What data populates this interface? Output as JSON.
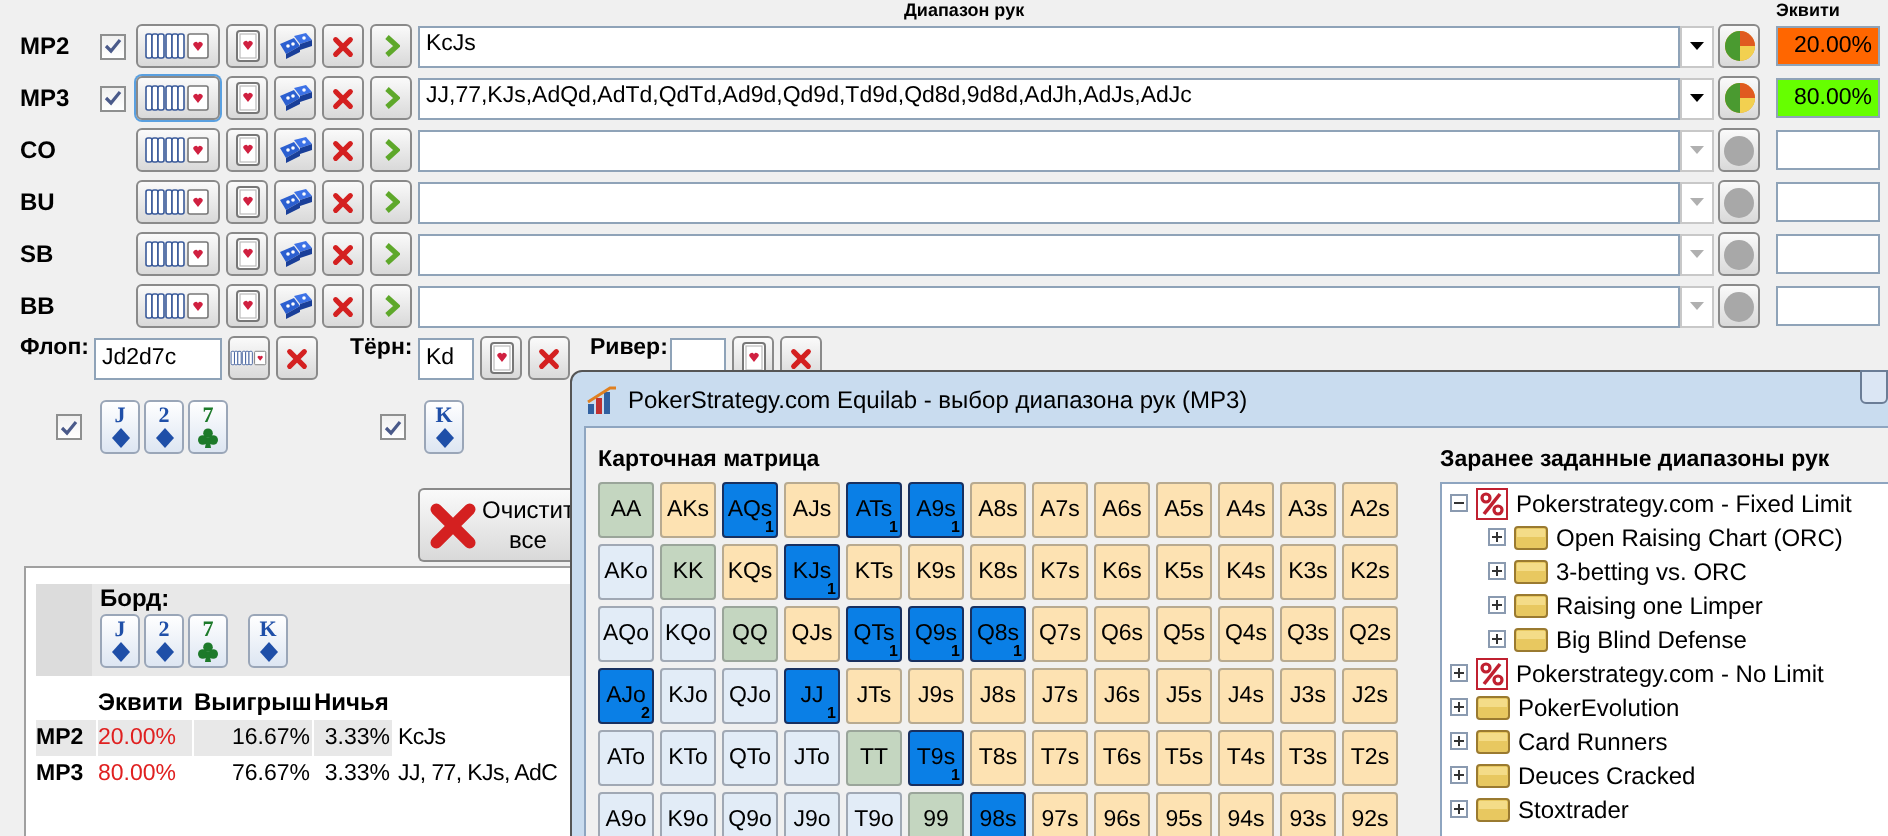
{
  "range_header": "Диапазон рук",
  "equity_header": "Эквити",
  "players": [
    {
      "name": "MP2",
      "active": true,
      "range": "KcJs",
      "equity": "20.00%",
      "color": "#ff6600"
    },
    {
      "name": "MP3",
      "active": true,
      "range": "JJ,77,KJs,AdQd,AdTd,QdTd,Ad9d,Qd9d,Td9d,Qd8d,9d8d,AdJh,AdJs,AdJc",
      "equity": "80.00%",
      "color": "#66ff00"
    },
    {
      "name": "CO",
      "active": false
    },
    {
      "name": "BU",
      "active": false
    },
    {
      "name": "SB",
      "active": false
    },
    {
      "name": "BB",
      "active": false
    }
  ],
  "board": {
    "flop": {
      "label": "Флоп:",
      "value": "Jd2d7c",
      "checked": true,
      "cards": [
        {
          "rank": "J",
          "kind": "diamond"
        },
        {
          "rank": "2",
          "kind": "diamond"
        },
        {
          "rank": "7",
          "kind": "club"
        }
      ]
    },
    "turn": {
      "label": "Тёрн:",
      "value": "Kd",
      "checked": true,
      "cards": [
        {
          "rank": "K",
          "kind": "diamond"
        }
      ]
    },
    "river": {
      "label": "Ривер:"
    }
  },
  "clear_button": {
    "lines": [
      "Очистит",
      "все"
    ]
  },
  "results": {
    "board_label": "Борд:",
    "board": [
      {
        "cards": [
          {
            "rank": "J",
            "kind": "diamond"
          },
          {
            "rank": "2",
            "kind": "diamond"
          },
          {
            "rank": "7",
            "kind": "club"
          }
        ]
      },
      {
        "cards": [
          {
            "rank": "K",
            "kind": "diamond"
          }
        ]
      }
    ],
    "columns": [
      "Эквити",
      "Выигрыш",
      "Ничья"
    ],
    "rows": [
      {
        "name": "MP2",
        "equity": "20.00%",
        "win": "16.67%",
        "tie": "3.33%",
        "hand": "KcJs"
      },
      {
        "name": "MP3",
        "equity": "80.00%",
        "win": "76.67%",
        "tie": "3.33%",
        "hand": "JJ, 77, KJs, AdC"
      }
    ]
  },
  "dialog": {
    "title": "PokerStrategy.com Equilab - выбор диапазона рук (MP3)",
    "matrix_title": "Карточная матрица",
    "presets_title": "Заранее заданные диапазоны рук",
    "matrix": [
      [
        {
          "label": "AA",
          "selected": false
        },
        {
          "label": "AKs",
          "selected": false
        },
        {
          "label": "AQs",
          "selected": true,
          "count": "1"
        },
        {
          "label": "AJs",
          "selected": false
        },
        {
          "label": "ATs",
          "selected": true,
          "count": "1"
        },
        {
          "label": "A9s",
          "selected": true,
          "count": "1"
        },
        {
          "label": "A8s",
          "selected": false
        },
        {
          "label": "A7s",
          "selected": false
        },
        {
          "label": "A6s",
          "selected": false
        },
        {
          "label": "A5s",
          "selected": false
        },
        {
          "label": "A4s",
          "selected": false
        },
        {
          "label": "A3s",
          "selected": false
        },
        {
          "label": "A2s",
          "selected": false
        }
      ],
      [
        {
          "label": "AKo",
          "selected": false
        },
        {
          "label": "KK",
          "selected": false
        },
        {
          "label": "KQs",
          "selected": false
        },
        {
          "label": "KJs",
          "selected": true,
          "count": "1"
        },
        {
          "label": "KTs",
          "selected": false
        },
        {
          "label": "K9s",
          "selected": false
        },
        {
          "label": "K8s",
          "selected": false
        },
        {
          "label": "K7s",
          "selected": false
        },
        {
          "label": "K6s",
          "selected": false
        },
        {
          "label": "K5s",
          "selected": false
        },
        {
          "label": "K4s",
          "selected": false
        },
        {
          "label": "K3s",
          "selected": false
        },
        {
          "label": "K2s",
          "selected": false
        }
      ],
      [
        {
          "label": "AQo",
          "selected": false
        },
        {
          "label": "KQo",
          "selected": false
        },
        {
          "label": "QQ",
          "selected": false
        },
        {
          "label": "QJs",
          "selected": false
        },
        {
          "label": "QTs",
          "selected": true,
          "count": "1"
        },
        {
          "label": "Q9s",
          "selected": true,
          "count": "1"
        },
        {
          "label": "Q8s",
          "selected": true,
          "count": "1"
        },
        {
          "label": "Q7s",
          "selected": false
        },
        {
          "label": "Q6s",
          "selected": false
        },
        {
          "label": "Q5s",
          "selected": false
        },
        {
          "label": "Q4s",
          "selected": false
        },
        {
          "label": "Q3s",
          "selected": false
        },
        {
          "label": "Q2s",
          "selected": false
        }
      ],
      [
        {
          "label": "AJo",
          "selected": true,
          "count": "2"
        },
        {
          "label": "KJo",
          "selected": false
        },
        {
          "label": "QJo",
          "selected": false
        },
        {
          "label": "JJ",
          "selected": true,
          "count": "1"
        },
        {
          "label": "JTs",
          "selected": false
        },
        {
          "label": "J9s",
          "selected": false
        },
        {
          "label": "J8s",
          "selected": false
        },
        {
          "label": "J7s",
          "selected": false
        },
        {
          "label": "J6s",
          "selected": false
        },
        {
          "label": "J5s",
          "selected": false
        },
        {
          "label": "J4s",
          "selected": false
        },
        {
          "label": "J3s",
          "selected": false
        },
        {
          "label": "J2s",
          "selected": false
        }
      ],
      [
        {
          "label": "ATo",
          "selected": false
        },
        {
          "label": "KTo",
          "selected": false
        },
        {
          "label": "QTo",
          "selected": false
        },
        {
          "label": "JTo",
          "selected": false
        },
        {
          "label": "TT",
          "selected": false
        },
        {
          "label": "T9s",
          "selected": true,
          "count": "1"
        },
        {
          "label": "T8s",
          "selected": false
        },
        {
          "label": "T7s",
          "selected": false
        },
        {
          "label": "T6s",
          "selected": false
        },
        {
          "label": "T5s",
          "selected": false
        },
        {
          "label": "T4s",
          "selected": false
        },
        {
          "label": "T3s",
          "selected": false
        },
        {
          "label": "T2s",
          "selected": false
        }
      ],
      [
        {
          "label": "A9o",
          "selected": false
        },
        {
          "label": "K9o",
          "selected": false
        },
        {
          "label": "Q9o",
          "selected": false
        },
        {
          "label": "J9o",
          "selected": false
        },
        {
          "label": "T9o",
          "selected": false
        },
        {
          "label": "99",
          "selected": false
        },
        {
          "label": "98s",
          "selected": true
        },
        {
          "label": "97s",
          "selected": false
        },
        {
          "label": "96s",
          "selected": false
        },
        {
          "label": "95s",
          "selected": false
        },
        {
          "label": "94s",
          "selected": false
        },
        {
          "label": "93s",
          "selected": false
        },
        {
          "label": "92s",
          "selected": false
        }
      ]
    ],
    "presets": [
      {
        "label": "Pokerstrategy.com - Fixed Limit",
        "kind": "strategy",
        "expanded": true,
        "children": [
          {
            "label": "Open Raising Chart (ORC)",
            "kind": "folder",
            "expanded": false
          },
          {
            "label": "3-betting vs. ORC",
            "kind": "folder",
            "expanded": false
          },
          {
            "label": "Raising one Limper",
            "kind": "folder",
            "expanded": false
          },
          {
            "label": "Big Blind Defense",
            "kind": "folder",
            "expanded": false
          }
        ]
      },
      {
        "label": "Pokerstrategy.com - No Limit",
        "kind": "strategy",
        "expanded": false
      },
      {
        "label": "PokerEvolution",
        "kind": "folder",
        "expanded": false
      },
      {
        "label": "Card Runners",
        "kind": "folder",
        "expanded": false
      },
      {
        "label": "Deuces Cracked",
        "kind": "folder",
        "expanded": false
      },
      {
        "label": "Stoxtrader",
        "kind": "folder",
        "expanded": false
      }
    ]
  }
}
